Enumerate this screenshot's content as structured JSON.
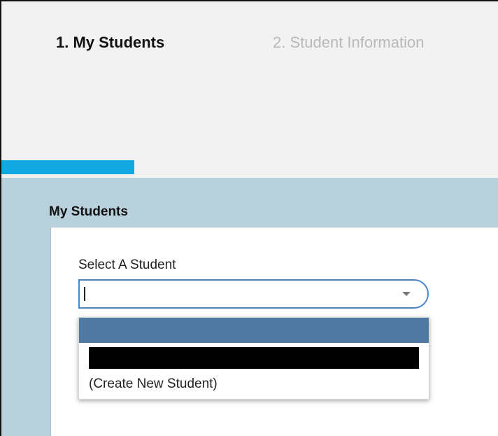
{
  "wizard": {
    "steps": [
      {
        "label": "1. My Students",
        "state": "active"
      },
      {
        "label": "2. Student Information",
        "state": "inactive"
      }
    ],
    "progress": 0.27,
    "colors": {
      "progress": "#14a8e0",
      "inactive_step": "#b9b9b9",
      "panel": "#b9d1dc"
    }
  },
  "section": {
    "title": "My Students"
  },
  "student_select": {
    "label": "Select A Student",
    "value": "",
    "options": [
      {
        "label": "",
        "state": "highlighted"
      },
      {
        "label": "",
        "state": "redacted"
      },
      {
        "label": "(Create New Student)"
      }
    ]
  }
}
